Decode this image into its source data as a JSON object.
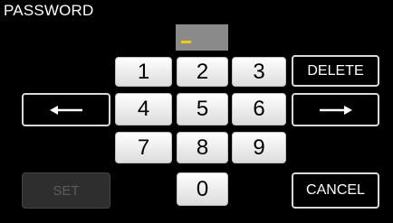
{
  "header": {
    "title": "PASSWORD"
  },
  "display": {
    "cursor_color": "#f2cc00"
  },
  "keypad": {
    "k1": "1",
    "k2": "2",
    "k3": "3",
    "k4": "4",
    "k5": "5",
    "k6": "6",
    "k7": "7",
    "k8": "8",
    "k9": "9",
    "k0": "0"
  },
  "buttons": {
    "delete": "DELETE",
    "set": "SET",
    "cancel": "CANCEL",
    "left_icon": "left-arrow-icon",
    "right_icon": "right-arrow-icon"
  }
}
